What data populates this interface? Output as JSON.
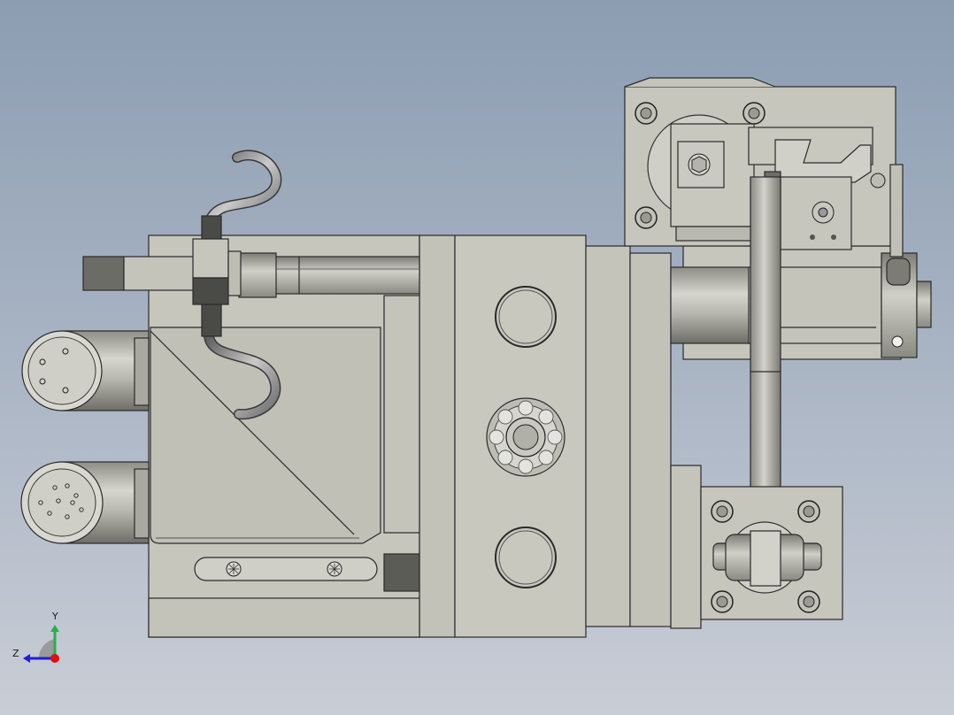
{
  "triad": {
    "y_label": "Y",
    "z_label": "Z"
  },
  "colors": {
    "background_top": "#8c9db2",
    "background_bottom": "#c9cdd6",
    "part_face": "#c6c6bd",
    "part_face_dark": "#9c9c94",
    "edge": "#2a2a2a",
    "triad_x": "#e01010",
    "triad_y": "#22b14c",
    "triad_z": "#2020d0"
  }
}
